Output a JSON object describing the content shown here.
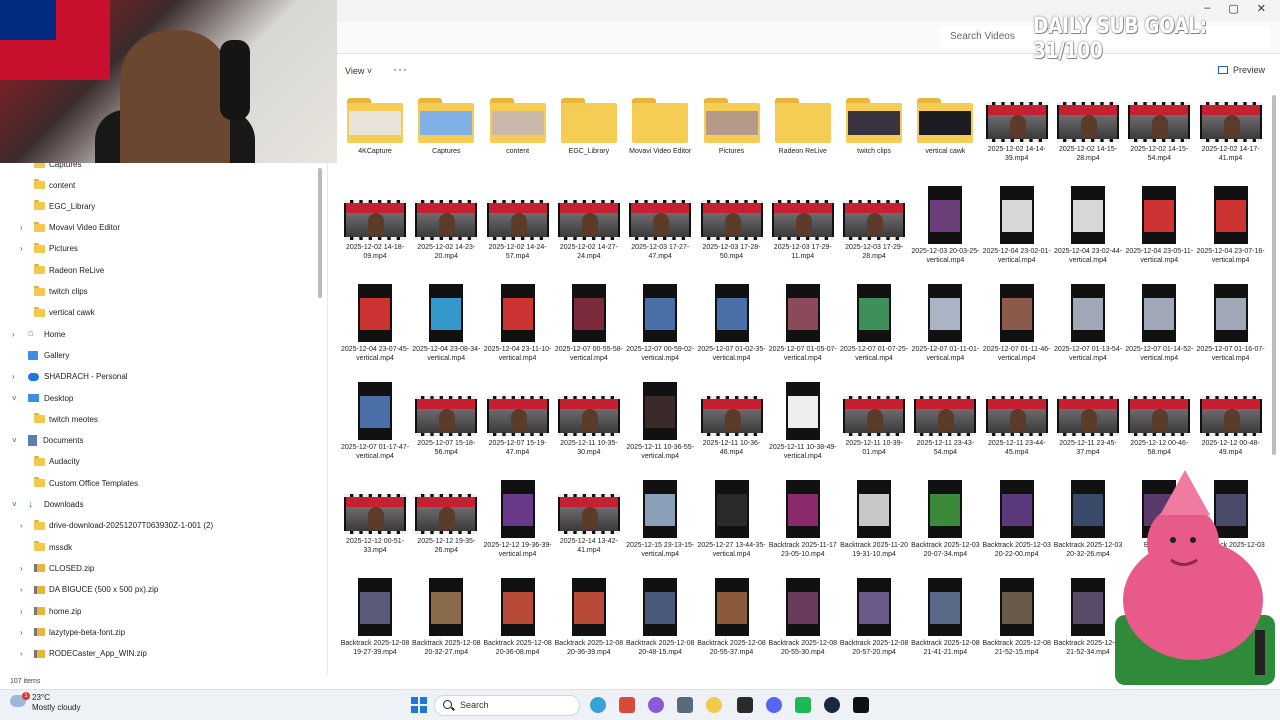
{
  "overlay": {
    "sub_goal": "DAILY SUB GOAL: 31/100"
  },
  "search": {
    "placeholder": "Search Videos"
  },
  "toolbar": {
    "view_label": "View",
    "more_label": "···",
    "preview_label": "Preview"
  },
  "window": {
    "minimize": "–",
    "maximize": "▢",
    "close": "✕"
  },
  "sidebar": {
    "items": [
      {
        "label": "Captures",
        "icon": "folder-icon",
        "indent": 1
      },
      {
        "label": "content",
        "icon": "folder-icon",
        "indent": 1
      },
      {
        "label": "EGC_Library",
        "icon": "folder-icon",
        "indent": 1
      },
      {
        "label": "Movavi Video Editor",
        "icon": "folder-icon",
        "indent": 1,
        "expand": true
      },
      {
        "label": "Pictures",
        "icon": "folder-icon",
        "indent": 1,
        "expand": true
      },
      {
        "label": "Radeon ReLive",
        "icon": "folder-icon",
        "indent": 1
      },
      {
        "label": "twitch clips",
        "icon": "folder-icon",
        "indent": 1
      },
      {
        "label": "vertical cawk",
        "icon": "folder-icon",
        "indent": 1
      },
      {
        "label": "Home",
        "icon": "home-icon",
        "indent": 0,
        "expand": true
      },
      {
        "label": "Gallery",
        "icon": "gallery-icon",
        "indent": 0
      },
      {
        "label": "SHADRACH - Personal",
        "icon": "cloud-icon",
        "indent": 0,
        "expand": true
      },
      {
        "label": "Desktop",
        "icon": "desktop-icon",
        "indent": 0,
        "open": true
      },
      {
        "label": "twitch meotes",
        "icon": "folder-icon",
        "indent": 1
      },
      {
        "label": "Documents",
        "icon": "documents-icon",
        "indent": 0,
        "open": true
      },
      {
        "label": "Audacity",
        "icon": "folder-icon",
        "indent": 1
      },
      {
        "label": "Custom Office Templates",
        "icon": "folder-icon",
        "indent": 1
      },
      {
        "label": "Downloads",
        "icon": "download-icon",
        "indent": 0,
        "open": true
      },
      {
        "label": "drive-download-20251207T063930Z-1-001 (2)",
        "icon": "folder-icon",
        "indent": 1,
        "expand": true
      },
      {
        "label": "mssdk",
        "icon": "folder-icon",
        "indent": 1
      },
      {
        "label": "CLOSED.zip",
        "icon": "zip-icon",
        "indent": 1,
        "expand": true
      },
      {
        "label": "DA BIGUCE (500 x 500 px).zip",
        "icon": "zip-icon",
        "indent": 1,
        "expand": true
      },
      {
        "label": "home.zip",
        "icon": "zip-icon",
        "indent": 1,
        "expand": true
      },
      {
        "label": "lazytype-beta-font.zip",
        "icon": "zip-icon",
        "indent": 1,
        "expand": true
      },
      {
        "label": "RODECaster_App_WIN.zip",
        "icon": "zip-icon",
        "indent": 1,
        "expand": true
      }
    ]
  },
  "status": {
    "item_count": "107 items"
  },
  "files": [
    {
      "name": "4KCapture",
      "kind": "folder",
      "img": "#e8e4dc"
    },
    {
      "name": "Captures",
      "kind": "folder",
      "img": "#7fb0e6"
    },
    {
      "name": "content",
      "kind": "folder",
      "img": "#c9b8a8"
    },
    {
      "name": "EGC_Library",
      "kind": "folder"
    },
    {
      "name": "Movavi Video Editor",
      "kind": "folder"
    },
    {
      "name": "Pictures",
      "kind": "folder",
      "img": "#b59a8a"
    },
    {
      "name": "Radeon ReLive",
      "kind": "folder"
    },
    {
      "name": "twitch clips",
      "kind": "folder",
      "img": "#3a3340"
    },
    {
      "name": "vertical cawk",
      "kind": "folder",
      "img": "#1c1c22"
    },
    {
      "name": "2025-12-02 14-14-39.mp4",
      "kind": "wide"
    },
    {
      "name": "2025-12-02 14-15-28.mp4",
      "kind": "wide"
    },
    {
      "name": "2025-12-02 14-15-54.mp4",
      "kind": "wide"
    },
    {
      "name": "2025-12-02 14-17-41.mp4",
      "kind": "wide"
    },
    {
      "name": "2025-12-02 14-18-09.mp4",
      "kind": "wide"
    },
    {
      "name": "2025-12-02 14-23-20.mp4",
      "kind": "wide"
    },
    {
      "name": "2025-12-02 14-24-57.mp4",
      "kind": "wide"
    },
    {
      "name": "2025-12-02 14-27-24.mp4",
      "kind": "wide"
    },
    {
      "name": "2025-12-03 17-27-47.mp4",
      "kind": "wide"
    },
    {
      "name": "2025-12-03 17-28-50.mp4",
      "kind": "wide"
    },
    {
      "name": "2025-12-03 17-29-11.mp4",
      "kind": "wide"
    },
    {
      "name": "2025-12-03 17-29-28.mp4",
      "kind": "wide"
    },
    {
      "name": "2025-12-03 20-03-25-vertical.mp4",
      "kind": "tall",
      "img": "#6b3f7a"
    },
    {
      "name": "2025-12-04 23-02-01-vertical.mp4",
      "kind": "tall",
      "img": "#d8d8d8"
    },
    {
      "name": "2025-12-04 23-02-44-vertical.mp4",
      "kind": "tall",
      "img": "#d8d8d8"
    },
    {
      "name": "2025-12-04 23-05-11-vertical.mp4",
      "kind": "tall",
      "img": "#c33"
    },
    {
      "name": "2025-12-04 23-07-16-vertical.mp4",
      "kind": "tall",
      "img": "#c33"
    },
    {
      "name": "2025-12-04 23-07-45-vertical.mp4",
      "kind": "tall",
      "img": "#c33"
    },
    {
      "name": "2025-12-04 23-08-34-vertical.mp4",
      "kind": "tall",
      "img": "#39c"
    },
    {
      "name": "2025-12-04 23-11-10-vertical.mp4",
      "kind": "tall",
      "img": "#c33"
    },
    {
      "name": "2025-12-07 00-55-58-vertical.mp4",
      "kind": "tall",
      "img": "#7a2a3a"
    },
    {
      "name": "2025-12-07 00-59-02-vertical.mp4",
      "kind": "tall",
      "img": "#4a6fa8"
    },
    {
      "name": "2025-12-07 01-02-35-vertical.mp4",
      "kind": "tall",
      "img": "#4a6fa8"
    },
    {
      "name": "2025-12-07 01-05-07-vertical.mp4",
      "kind": "tall",
      "img": "#8a4a5a"
    },
    {
      "name": "2025-12-07 01-07-25-vertical.mp4",
      "kind": "tall",
      "img": "#3f8f5a"
    },
    {
      "name": "2025-12-07 01-11-01-vertical.mp4",
      "kind": "tall",
      "img": "#aab4c4"
    },
    {
      "name": "2025-12-07 01-11-46-vertical.mp4",
      "kind": "tall",
      "img": "#8a5a4a"
    },
    {
      "name": "2025-12-07 01-13-54-vertical.mp4",
      "kind": "tall",
      "img": "#a0a8b8"
    },
    {
      "name": "2025-12-07 01-14-52-vertical.mp4",
      "kind": "tall",
      "img": "#a0a8b8"
    },
    {
      "name": "2025-12-07 01-16-07-vertical.mp4",
      "kind": "tall",
      "img": "#a0a8b8"
    },
    {
      "name": "2025-12-07 01-17-47-vertical.mp4",
      "kind": "tall",
      "img": "#4a6fa8"
    },
    {
      "name": "2025-12-07 15-18-56.mp4",
      "kind": "wide"
    },
    {
      "name": "2025-12-07 15-19-47.mp4",
      "kind": "wide"
    },
    {
      "name": "2025-12-11 10-35-30.mp4",
      "kind": "wide"
    },
    {
      "name": "2025-12-11 10-36-55-vertical.mp4",
      "kind": "tall",
      "img": "#3a2a2a"
    },
    {
      "name": "2025-12-11 10-36-46.mp4",
      "kind": "wide"
    },
    {
      "name": "2025-12-11 10-38-49-vertical.mp4",
      "kind": "tall",
      "img": "#eeeeee"
    },
    {
      "name": "2025-12-11 10-39-01.mp4",
      "kind": "wide"
    },
    {
      "name": "2025-12-11 23-43-54.mp4",
      "kind": "wide"
    },
    {
      "name": "2025-12-11 23-44-45.mp4",
      "kind": "wide"
    },
    {
      "name": "2025-12-11 23-45-37.mp4",
      "kind": "wide"
    },
    {
      "name": "2025-12-12 00-46-58.mp4",
      "kind": "wide"
    },
    {
      "name": "2025-12-12 00-48-49.mp4",
      "kind": "wide"
    },
    {
      "name": "2025-12-12 00-51-33.mp4",
      "kind": "wide"
    },
    {
      "name": "2025-12-12 19-35-26.mp4",
      "kind": "wide"
    },
    {
      "name": "2025-12-12 19-36-39-vertical.mp4",
      "kind": "tall",
      "img": "#6a3a8a"
    },
    {
      "name": "2025-12-14 13-42-41.mp4",
      "kind": "wide"
    },
    {
      "name": "2025-12-15 23-13-15-vertical.mp4",
      "kind": "tall",
      "img": "#8aa0b8"
    },
    {
      "name": "2025-12-27 13-44-35-vertical.mp4",
      "kind": "tall",
      "img": "#2a2a2a"
    },
    {
      "name": "Backtrack 2025-11-17 23-05-10.mp4",
      "kind": "tall",
      "img": "#8a2a6a"
    },
    {
      "name": "Backtrack 2025-11-20 19-31-10.mp4",
      "kind": "tall",
      "img": "#c8c8c8"
    },
    {
      "name": "Backtrack 2025-12-03 20-07-34.mp4",
      "kind": "tall",
      "img": "#3a8a3a"
    },
    {
      "name": "Backtrack 2025-12-03 20-22-00.mp4",
      "kind": "tall",
      "img": "#5a3a7a"
    },
    {
      "name": "Backtrack 2025-12-03 20-32-26.mp4",
      "kind": "tall",
      "img": "#3a4a6a"
    },
    {
      "name": "Backtrack",
      "kind": "tall",
      "img": "#5a3a6a"
    },
    {
      "name": "Backtrack 2025-12-03",
      "kind": "tall",
      "img": "#4a4a6a"
    },
    {
      "name": "Backtrack 2025-12-08 19-27-39.mp4",
      "kind": "tall",
      "img": "#5a5a7a"
    },
    {
      "name": "Backtrack 2025-12-08 20-32-27.mp4",
      "kind": "tall",
      "img": "#8a6a4a"
    },
    {
      "name": "Backtrack 2025-12-08 20-36-08.mp4",
      "kind": "tall",
      "img": "#b84a3a"
    },
    {
      "name": "Backtrack 2025-12-08 20-36-39.mp4",
      "kind": "tall",
      "img": "#b84a3a"
    },
    {
      "name": "Backtrack 2025-12-08 20-48-15.mp4",
      "kind": "tall",
      "img": "#4a5a7a"
    },
    {
      "name": "Backtrack 2025-12-08 20-55-37.mp4",
      "kind": "tall",
      "img": "#8a5a3a"
    },
    {
      "name": "Backtrack 2025-12-08 20-55-30.mp4",
      "kind": "tall",
      "img": "#6a3a5a"
    },
    {
      "name": "Backtrack 2025-12-08 20-57-20.mp4",
      "kind": "tall",
      "img": "#6a5a8a"
    },
    {
      "name": "Backtrack 2025-12-08 21-41-21.mp4",
      "kind": "tall",
      "img": "#5a6a8a"
    },
    {
      "name": "Backtrack 2025-12-08 21-52-15.mp4",
      "kind": "tall",
      "img": "#6a5a4a"
    },
    {
      "name": "Backtrack 2025-12-08 21-52-34.mp4",
      "kind": "tall",
      "img": "#5a4a6a"
    }
  ],
  "taskbar": {
    "temperature": "23°C",
    "conditions": "Mostly cloudy",
    "notification_count": "1",
    "search_label": "Search",
    "apps": [
      {
        "name": "start-icon",
        "color": "#1e78d7"
      },
      {
        "name": "copilot-icon",
        "color": "#3aa0d8"
      },
      {
        "name": "chrome-icon",
        "color": "#d94a3a"
      },
      {
        "name": "photos-icon",
        "color": "#8a5ad8"
      },
      {
        "name": "settings-icon",
        "color": "#5a6a7a"
      },
      {
        "name": "file-explorer-icon",
        "color": "#f2c94c"
      },
      {
        "name": "obs-icon",
        "color": "#2a2a2a"
      },
      {
        "name": "discord-icon",
        "color": "#5865f2"
      },
      {
        "name": "spotify-icon",
        "color": "#1db954"
      },
      {
        "name": "steam-icon",
        "color": "#1b2838"
      },
      {
        "name": "unreal-icon",
        "color": "#111111"
      }
    ]
  }
}
